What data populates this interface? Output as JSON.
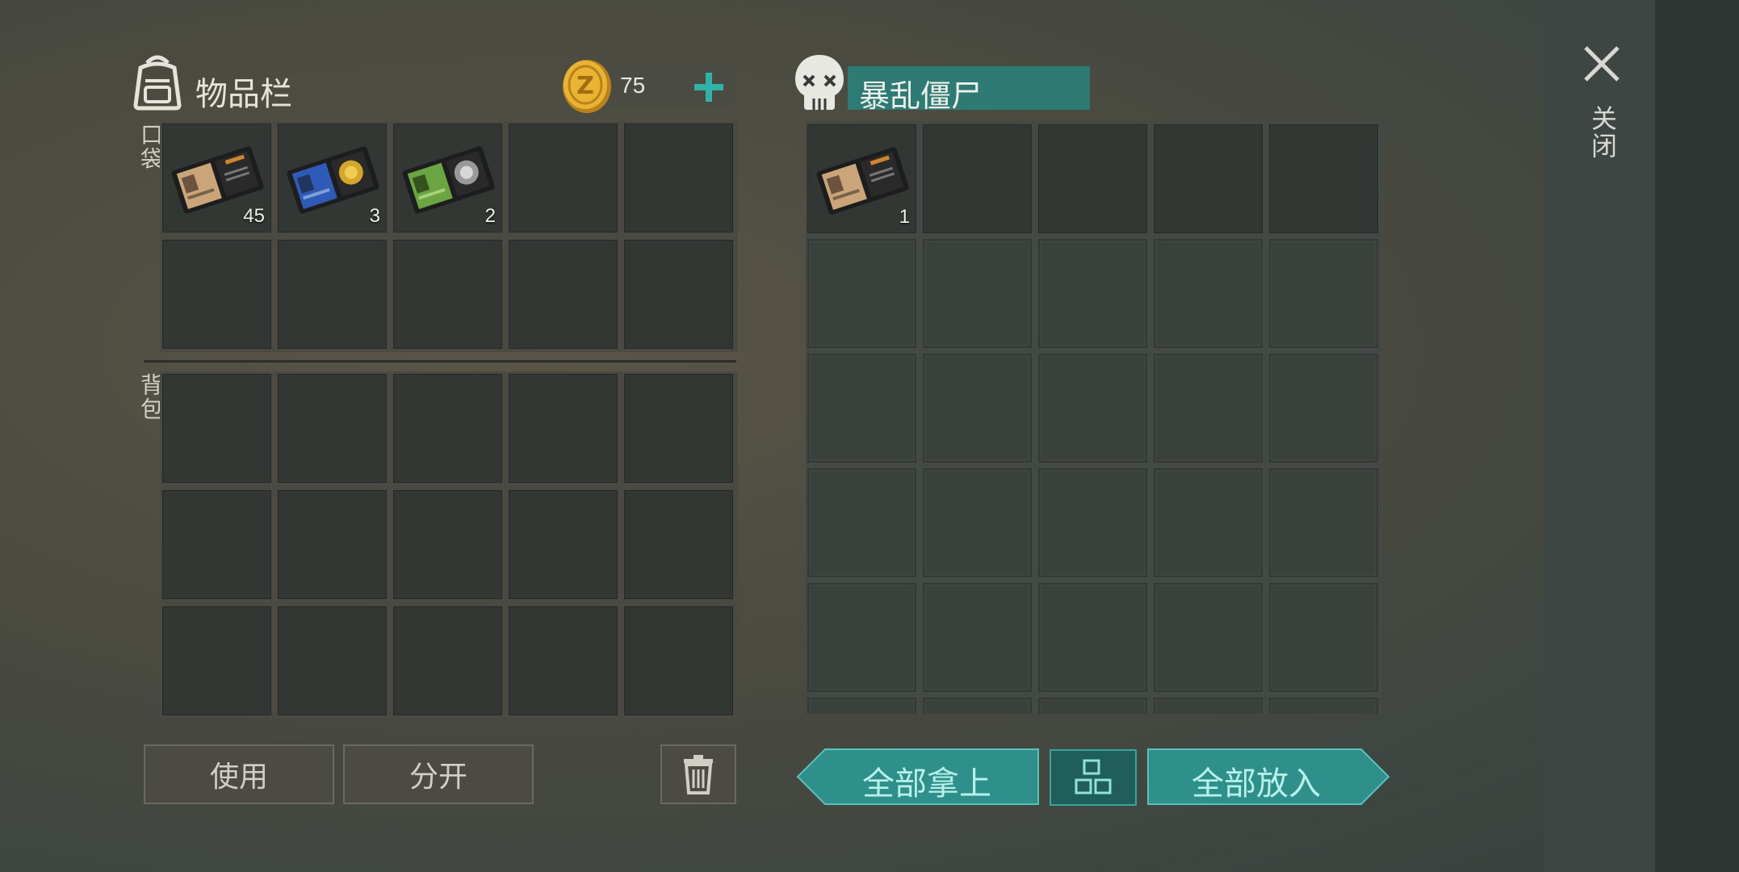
{
  "inventory": {
    "title": "物品栏",
    "coins": "75",
    "pocket_label": "口袋",
    "backpack_label": "背包",
    "pocket_items": [
      {
        "icon": "patrol-officer-id-wallet-icon",
        "count": "45",
        "card_color": "#caa57a"
      },
      {
        "icon": "police-badge-id-wallet-icon",
        "count": "3",
        "card_color": "#2f5bb8"
      },
      {
        "icon": "silver-badge-id-wallet-icon",
        "count": "2",
        "card_color": "#6aa541"
      }
    ]
  },
  "loot": {
    "title": "暴乱僵尸",
    "items": [
      {
        "icon": "patrol-officer-id-wallet-icon",
        "count": "1",
        "card_color": "#caa57a"
      }
    ]
  },
  "buttons": {
    "use": "使用",
    "split": "分开",
    "take_all": "全部拿上",
    "put_all": "全部放入",
    "close": "关闭"
  },
  "colors": {
    "accent_teal": "#2f8f8a",
    "coin_gold": "#e0a92a"
  }
}
